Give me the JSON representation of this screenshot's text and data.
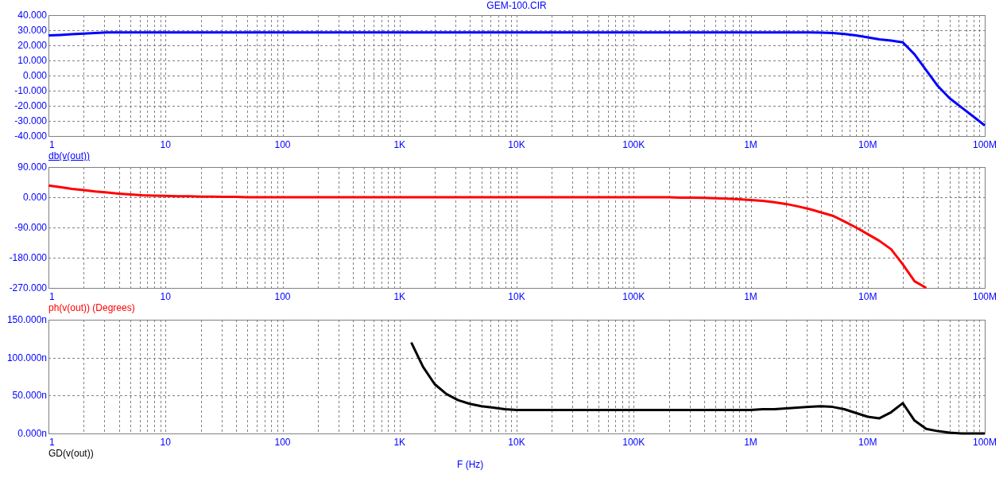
{
  "title": "GEM-100.CIR",
  "panels": [
    {
      "selected": true,
      "chart_data": {
        "type": "line",
        "grid": true,
        "categories": [
          "1",
          null,
          null,
          null,
          null,
          null,
          null,
          null,
          null,
          null,
          "10",
          null,
          null,
          null,
          null,
          null,
          null,
          null,
          null,
          null,
          "100",
          null,
          null,
          null,
          null,
          null,
          null,
          null,
          null,
          null,
          "1K",
          null,
          null,
          null,
          null,
          null,
          null,
          null,
          null,
          null,
          "10K",
          null,
          null,
          null,
          null,
          null,
          null,
          null,
          null,
          null,
          "100K",
          null,
          null,
          null,
          null,
          null,
          null,
          null,
          null,
          null,
          "1M",
          null,
          null,
          null,
          null,
          null,
          null,
          null,
          null,
          null,
          "10M",
          null,
          null,
          null,
          null,
          null,
          null,
          null,
          null,
          null,
          "100M"
        ],
        "series": [
          {
            "name": "db(v(out))",
            "color": "#0000ff",
            "values": [
              26.5,
              26.9,
              27.3,
              27.8,
              28.2,
              28.5,
              28.5,
              28.5,
              28.5,
              28.5,
              28.5,
              28.5,
              28.5,
              28.5,
              28.5,
              28.5,
              28.5,
              28.5,
              28.5,
              28.5,
              28.5,
              28.5,
              28.5,
              28.5,
              28.5,
              28.5,
              28.5,
              28.5,
              28.5,
              28.5,
              28.5,
              28.5,
              28.5,
              28.5,
              28.5,
              28.5,
              28.5,
              28.5,
              28.5,
              28.5,
              28.5,
              28.5,
              28.5,
              28.5,
              28.5,
              28.5,
              28.5,
              28.5,
              28.5,
              28.5,
              28.5,
              28.5,
              28.5,
              28.5,
              28.5,
              28.5,
              28.5,
              28.5,
              28.5,
              28.5,
              28.5,
              28.5,
              28.5,
              28.5,
              28.5,
              28.5,
              28.4,
              28.2,
              27.5,
              26.5,
              25.2,
              24,
              23.1,
              22,
              14,
              3.5,
              -7,
              -15,
              -21,
              -27,
              -33
            ]
          }
        ],
        "ylim": [
          -40,
          40
        ],
        "yticks": [
          {
            "value": 40,
            "label": "40.000"
          },
          {
            "value": 30,
            "label": "30.000"
          },
          {
            "value": 20,
            "label": "20.000"
          },
          {
            "value": 10,
            "label": "10.000"
          },
          {
            "value": 0,
            "label": "0.000"
          },
          {
            "value": -10,
            "label": "-10.000"
          },
          {
            "value": -20,
            "label": "-20.000"
          },
          {
            "value": -30,
            "label": "-30.000"
          },
          {
            "value": -40,
            "label": "-40.000"
          }
        ]
      }
    },
    {
      "selected": false,
      "chart_data": {
        "type": "line",
        "grid": true,
        "categories": [
          "1",
          null,
          null,
          null,
          null,
          null,
          null,
          null,
          null,
          null,
          "10",
          null,
          null,
          null,
          null,
          null,
          null,
          null,
          null,
          null,
          "100",
          null,
          null,
          null,
          null,
          null,
          null,
          null,
          null,
          null,
          "1K",
          null,
          null,
          null,
          null,
          null,
          null,
          null,
          null,
          null,
          "10K",
          null,
          null,
          null,
          null,
          null,
          null,
          null,
          null,
          null,
          "100K",
          null,
          null,
          null,
          null,
          null,
          null,
          null,
          null,
          null,
          "1M",
          null,
          null,
          null,
          null,
          null,
          null,
          null,
          null,
          null,
          "10M",
          null,
          null,
          null,
          null,
          null,
          null,
          null,
          null,
          null,
          "100M"
        ],
        "series": [
          {
            "name": "ph(v(out)) (Degrees)",
            "color": "#ff0000",
            "values": [
              35,
              30,
              25,
              21,
              17,
              14,
              11,
              8,
              6,
              5,
              4,
              3,
              3,
              2,
              2,
              1,
              1,
              0,
              0,
              0,
              0,
              0,
              0,
              0,
              0,
              0,
              0,
              0,
              0,
              0,
              0,
              0,
              0,
              0,
              0,
              0,
              0,
              0,
              0,
              0,
              0,
              0,
              0,
              0,
              0,
              0,
              0,
              0,
              0,
              0,
              0,
              0,
              0,
              0,
              -1,
              -1,
              -2,
              -3,
              -4,
              -6,
              -8,
              -11,
              -15,
              -20,
              -27,
              -35,
              -45,
              -55,
              -72,
              -90,
              -110,
              -130,
              -155,
              -200,
              -250,
              -270,
              null,
              null,
              null,
              null,
              null
            ]
          }
        ],
        "ylim": [
          -270,
          90
        ],
        "yticks": [
          {
            "value": 90,
            "label": "90.000"
          },
          {
            "value": 0,
            "label": "0.000"
          },
          {
            "value": -90,
            "label": "-90.000"
          },
          {
            "value": -180,
            "label": "-180.000"
          },
          {
            "value": -270,
            "label": "-270.000"
          }
        ]
      }
    },
    {
      "selected": false,
      "chart_data": {
        "type": "line",
        "grid": true,
        "xlabel": "F (Hz)",
        "categories": [
          "1",
          null,
          null,
          null,
          null,
          null,
          null,
          null,
          null,
          null,
          "10",
          null,
          null,
          null,
          null,
          null,
          null,
          null,
          null,
          null,
          "100",
          null,
          null,
          null,
          null,
          null,
          null,
          null,
          null,
          null,
          "1K",
          null,
          null,
          null,
          null,
          null,
          null,
          null,
          null,
          null,
          "10K",
          null,
          null,
          null,
          null,
          null,
          null,
          null,
          null,
          null,
          "100K",
          null,
          null,
          null,
          null,
          null,
          null,
          null,
          null,
          null,
          "1M",
          null,
          null,
          null,
          null,
          null,
          null,
          null,
          null,
          null,
          "10M",
          null,
          null,
          null,
          null,
          null,
          null,
          null,
          null,
          null,
          "100M"
        ],
        "series": [
          {
            "name": "GD(v(out))",
            "color": "#000000",
            "values": [
              null,
              null,
              null,
              null,
              null,
              null,
              null,
              null,
              null,
              null,
              null,
              null,
              null,
              null,
              null,
              null,
              null,
              null,
              null,
              null,
              null,
              null,
              null,
              null,
              null,
              null,
              null,
              null,
              null,
              null,
              null,
              120,
              88,
              65,
              52,
              44,
              39,
              36,
              34,
              32,
              31,
              31,
              31,
              31,
              31,
              31,
              31,
              31,
              31,
              31,
              31,
              31,
              31,
              31,
              31,
              31,
              31,
              31,
              31,
              31,
              31,
              32,
              32,
              33,
              34,
              35,
              36,
              35,
              32,
              27,
              22,
              20,
              28,
              40,
              17,
              6,
              3,
              1,
              0,
              0,
              0
            ]
          }
        ],
        "ylim": [
          0,
          150
        ],
        "yticks": [
          {
            "value": 150,
            "label": "150.000n"
          },
          {
            "value": 100,
            "label": "100.000n"
          },
          {
            "value": 50,
            "label": "50.000n"
          },
          {
            "value": 0,
            "label": "0.000n"
          }
        ]
      }
    }
  ]
}
